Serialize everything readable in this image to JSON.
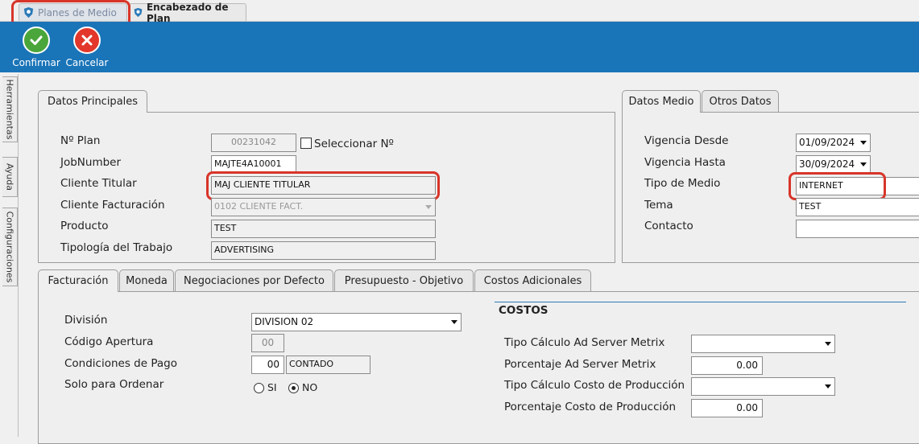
{
  "doc_tabs": [
    {
      "label": "Planes de Medio"
    },
    {
      "label": "Encabezado de Plan"
    }
  ],
  "ribbon": {
    "confirm_label": "Confirmar",
    "cancel_label": "Cancelar"
  },
  "side_tabs": [
    "Herramientas",
    "Ayuda",
    "Configuraciones"
  ],
  "datos_principales": {
    "tab_label": "Datos Principales",
    "plan_label": "Nº Plan",
    "plan_value": "00231042",
    "select_label": "Seleccionar Nº",
    "job_label": "JobNumber",
    "job_value": "MAJTE4A10001",
    "cliente_titular_label": "Cliente Titular",
    "cliente_titular_value": "MAJ CLIENTE TITULAR",
    "cliente_fact_label": "Cliente Facturación",
    "cliente_fact_value": "0102 CLIENTE FACT.",
    "producto_label": "Producto",
    "producto_value": "TEST",
    "tipologia_label": "Tipología del Trabajo",
    "tipologia_value": "ADVERTISING"
  },
  "datos_medio": {
    "tabs": [
      "Datos Medio",
      "Otros Datos"
    ],
    "vig_desde_label": "Vigencia Desde",
    "vig_desde_value": "01/09/2024",
    "vig_hasta_label": "Vigencia Hasta",
    "vig_hasta_value": "30/09/2024",
    "tipo_medio_label": "Tipo de Medio",
    "tipo_medio_value": "INTERNET",
    "tema_label": "Tema",
    "tema_value": "TEST",
    "contacto_label": "Contacto",
    "contacto_value": ""
  },
  "bottom_tabs": [
    "Facturación",
    "Moneda",
    "Negociaciones por Defecto",
    "Presupuesto - Objetivo",
    "Costos Adicionales"
  ],
  "facturacion": {
    "division_label": "División",
    "division_value": "DIVISION 02",
    "codigo_label": "Código Apertura",
    "codigo_value": "00",
    "condiciones_label": "Condiciones de Pago",
    "condiciones_code": "00",
    "condiciones_value": "CONTADO",
    "solo_label": "Solo para Ordenar",
    "si_label": "SI",
    "no_label": "NO"
  },
  "costos": {
    "title": "COSTOS",
    "tipo_ad_label": "Tipo Cálculo Ad Server Metrix",
    "tipo_ad_value": "",
    "porc_ad_label": "Porcentaje Ad Server Metrix",
    "porc_ad_value": "0.00",
    "tipo_prod_label": "Tipo Cálculo Costo de Producción",
    "tipo_prod_value": "",
    "porc_prod_label": "Porcentaje Costo de Producción",
    "porc_prod_value": "0.00"
  },
  "colors": {
    "ribbon": "#1a74b8",
    "highlight": "#d8352a"
  }
}
